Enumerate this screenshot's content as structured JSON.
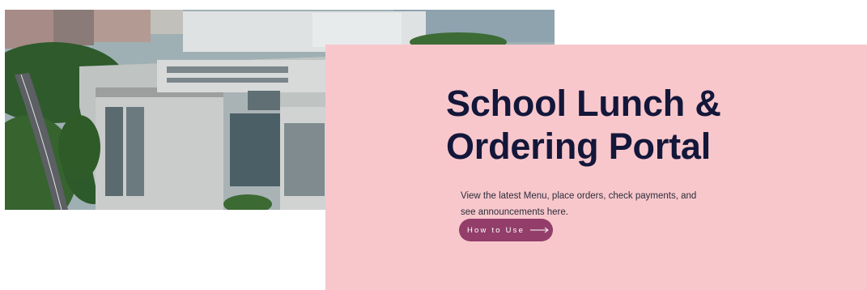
{
  "hero": {
    "title_line1": "School Lunch &",
    "title_line2": "Ordering Portal",
    "description": "View the latest Menu, place orders, check payments, and see announcements here.",
    "cta_label": "How to Use",
    "cta_icon": "arrow-right-icon",
    "photo_icon": "campus-building-photo"
  },
  "colors": {
    "panel_bg": "#f8c7cc",
    "title": "#13173a",
    "button_bg": "#933e6a",
    "button_text": "#ffffff"
  }
}
